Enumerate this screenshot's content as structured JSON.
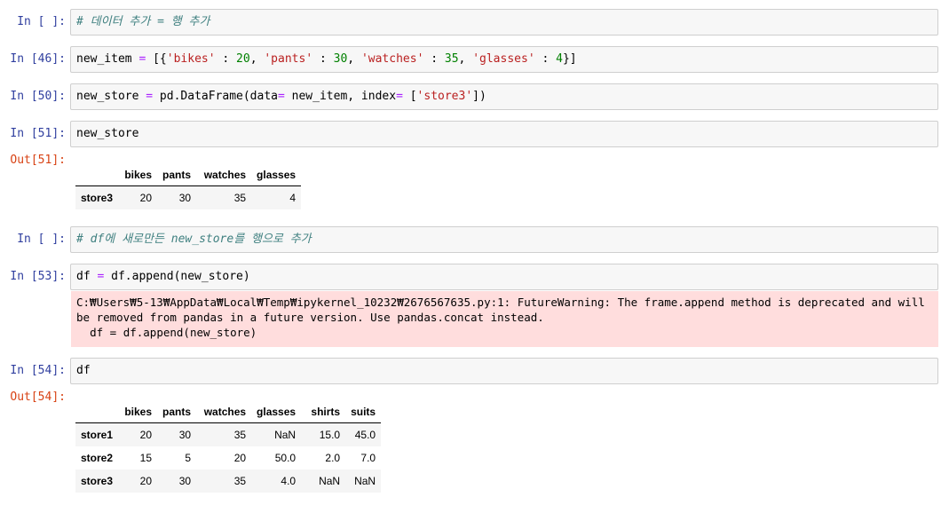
{
  "cells": {
    "c1": {
      "prompt": "In [ ]:",
      "code": [
        {
          "t": "# 데이터 추가 = 행 추가",
          "c": "comment"
        }
      ]
    },
    "c2": {
      "prompt": "In [46]:",
      "code": [
        {
          "t": "new_item ",
          "c": ""
        },
        {
          "t": "=",
          "c": "op"
        },
        {
          "t": " [{",
          "c": ""
        },
        {
          "t": "'bikes'",
          "c": "str"
        },
        {
          "t": " : ",
          "c": ""
        },
        {
          "t": "20",
          "c": "num"
        },
        {
          "t": ", ",
          "c": ""
        },
        {
          "t": "'pants'",
          "c": "str"
        },
        {
          "t": " : ",
          "c": ""
        },
        {
          "t": "30",
          "c": "num"
        },
        {
          "t": ", ",
          "c": ""
        },
        {
          "t": "'watches'",
          "c": "str"
        },
        {
          "t": " : ",
          "c": ""
        },
        {
          "t": "35",
          "c": "num"
        },
        {
          "t": ", ",
          "c": ""
        },
        {
          "t": "'glasses'",
          "c": "str"
        },
        {
          "t": " : ",
          "c": ""
        },
        {
          "t": "4",
          "c": "num"
        },
        {
          "t": "}]",
          "c": ""
        }
      ]
    },
    "c3": {
      "prompt": "In [50]:",
      "code": [
        {
          "t": "new_store ",
          "c": ""
        },
        {
          "t": "=",
          "c": "op"
        },
        {
          "t": " pd.DataFrame(data",
          "c": ""
        },
        {
          "t": "=",
          "c": "op"
        },
        {
          "t": " new_item, index",
          "c": ""
        },
        {
          "t": "=",
          "c": "op"
        },
        {
          "t": " [",
          "c": ""
        },
        {
          "t": "'store3'",
          "c": "str"
        },
        {
          "t": "])",
          "c": ""
        }
      ]
    },
    "c4": {
      "prompt": "In [51]:",
      "code": [
        {
          "t": "new_store",
          "c": ""
        }
      ],
      "out_prompt": "Out[51]:"
    },
    "c5": {
      "prompt": "In [ ]:",
      "code": [
        {
          "t": "# df에 새로만든 new_store를 행으로 추가",
          "c": "comment"
        }
      ]
    },
    "c6": {
      "prompt": "In [53]:",
      "code": [
        {
          "t": "df ",
          "c": ""
        },
        {
          "t": "=",
          "c": "op"
        },
        {
          "t": " df.append(new_store)",
          "c": ""
        }
      ],
      "stderr": "C:₩Users₩5-13₩AppData₩Local₩Temp₩ipykernel_10232₩2676567635.py:1: FutureWarning: The frame.append method is deprecated and will be removed from pandas in a future version. Use pandas.concat instead.\n  df = df.append(new_store)"
    },
    "c7": {
      "prompt": "In [54]:",
      "code": [
        {
          "t": "df",
          "c": ""
        }
      ],
      "out_prompt": "Out[54]:"
    }
  },
  "table1": {
    "columns": [
      "",
      "bikes",
      "pants",
      "watches",
      "glasses"
    ],
    "rows": [
      [
        "store3",
        "20",
        "30",
        "35",
        "4"
      ]
    ]
  },
  "table2": {
    "columns": [
      "",
      "bikes",
      "pants",
      "watches",
      "glasses",
      "shirts",
      "suits"
    ],
    "rows": [
      [
        "store1",
        "20",
        "30",
        "35",
        "NaN",
        "15.0",
        "45.0"
      ],
      [
        "store2",
        "15",
        "5",
        "20",
        "50.0",
        "2.0",
        "7.0"
      ],
      [
        "store3",
        "20",
        "30",
        "35",
        "4.0",
        "NaN",
        "NaN"
      ]
    ]
  },
  "colors": {
    "in_prompt": "#303f9f",
    "out_prompt": "#d84315",
    "stderr_bg": "#ffdddd",
    "input_bg": "#f7f7f7"
  }
}
